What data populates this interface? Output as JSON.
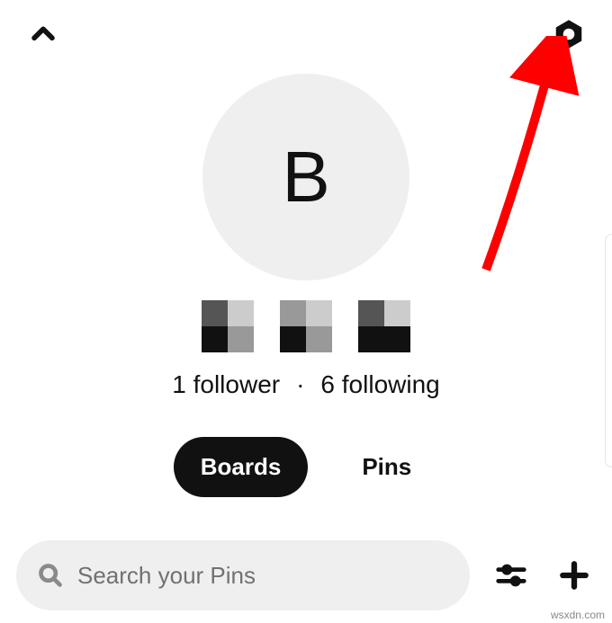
{
  "topbar": {
    "back_icon": "chevron-up",
    "settings_icon": "hexagon-gear"
  },
  "profile": {
    "avatar_initial": "B",
    "followers_text": "1 follower",
    "separator": "·",
    "following_text": "6 following"
  },
  "tabs": {
    "boards_label": "Boards",
    "pins_label": "Pins",
    "active": "Boards"
  },
  "search": {
    "placeholder": "Search your Pins"
  },
  "bottom": {
    "filter_icon": "sliders",
    "add_icon": "plus"
  },
  "annotation": {
    "arrow_color": "#ff0000"
  },
  "watermark": "wsxdn.com"
}
